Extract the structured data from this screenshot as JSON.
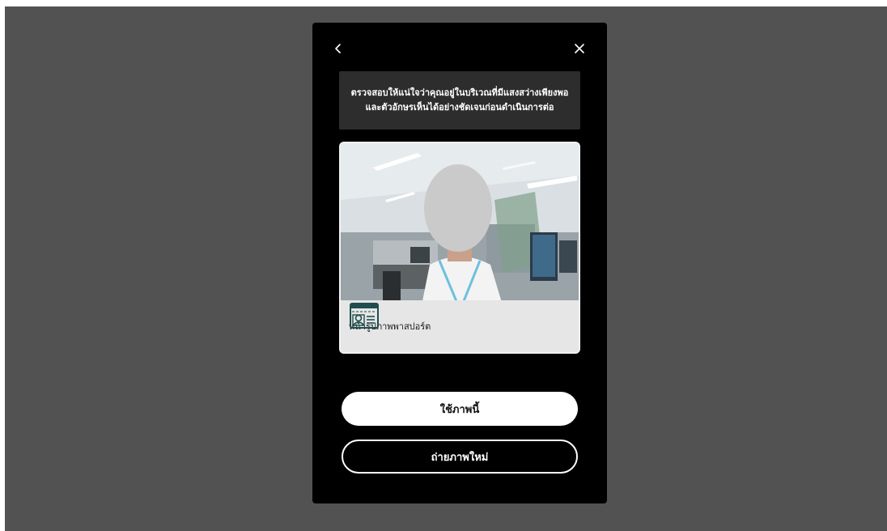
{
  "modal": {
    "notice": "ตรวจสอบให้แน่ใจว่าคุณอยู่ในบริเวณที่มีแสงสว่างเพียงพอและตัวอักษรเห็นได้อย่างชัดเจนก่อนดำเนินการต่อ",
    "back_icon": "chevron-left-icon",
    "close_icon": "close-icon"
  },
  "preview": {
    "document_label": "หน้ารูปภาพพาสปอร์ต",
    "document_icon": "id-card-icon"
  },
  "actions": {
    "use_photo_label": "ใช้ภาพนี้",
    "retake_label": "ถ่ายภาพใหม่"
  },
  "colors": {
    "backdrop": "#525252",
    "modal": "#000000",
    "notice_bg": "#2d2d2d",
    "icon_accent": "#1f4e4f"
  }
}
